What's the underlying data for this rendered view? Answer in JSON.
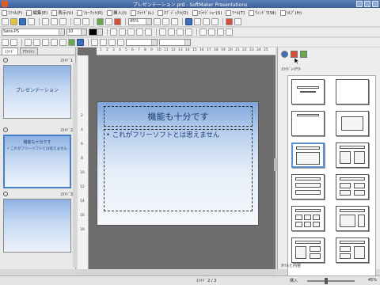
{
  "window": {
    "title": "プレゼンテーション.prd - SoftMaker Presentations"
  },
  "menu": {
    "items": [
      {
        "label": "ﾌｧｲﾙ(F)"
      },
      {
        "label": "編集(E)"
      },
      {
        "label": "表示(V)"
      },
      {
        "label": "ﾌｫｰﾏｯﾄ(R)"
      },
      {
        "label": "挿入(I)"
      },
      {
        "label": "ｽﾗｲﾄﾞ(L)"
      },
      {
        "label": "ｵﾌﾞｼﾞｪｸﾄ(O)"
      },
      {
        "label": "ｽﾗｲﾄﾞｼｮｰ(S)"
      },
      {
        "label": "ﾂｰﾙ(T)"
      },
      {
        "label": "ｳｨﾝﾄﾞｳ(W)"
      },
      {
        "label": "ﾍﾙﾌﾟ(H)"
      }
    ]
  },
  "toolbar": {
    "zoom": "45%",
    "font_name": "Sans-PS",
    "font_size": "10"
  },
  "left_panel": {
    "tabs": [
      "ｽﾗｲﾄﾞ",
      "ｱｳﾄﾗｲﾝ"
    ],
    "slides": [
      {
        "label": "ｽﾗｲﾄﾞ1",
        "title": "プレゼンテーション",
        "bullet": ""
      },
      {
        "label": "ｽﾗｲﾄﾞ2",
        "title": "機能も十分です",
        "bullet": "• これがフリーソフトとは思えません"
      },
      {
        "label": "ｽﾗｲﾄﾞ3",
        "title": "",
        "bullet": ""
      }
    ]
  },
  "slide": {
    "title": "機能も十分です",
    "bullet": "• これがフリーソフトとは思えません"
  },
  "right_panel": {
    "heading": "ｽﾗｲﾄﾞﾚｲｱｳﾄ",
    "footer": "ﾀｲﾄﾙと内容"
  },
  "status": {
    "page": "ｽﾗｲﾄﾞ 2 / 3",
    "mode": "挿入",
    "zoom": "45%"
  },
  "ruler": {
    "h_ticks": [
      "1",
      "2",
      "3",
      "4",
      "5",
      "6",
      "7",
      "8",
      "9",
      "10",
      "11",
      "12",
      "13",
      "14",
      "15",
      "16",
      "17",
      "18",
      "19",
      "20",
      "21",
      "22",
      "23",
      "24",
      "25"
    ],
    "v_ticks": [
      "2",
      "4",
      "6",
      "8",
      "10",
      "12",
      "14",
      "16",
      "18"
    ]
  },
  "colors": {
    "title_bar": "#4a6fa8",
    "slide_text": "#1d3e73",
    "selection": "#5a8fd0"
  }
}
